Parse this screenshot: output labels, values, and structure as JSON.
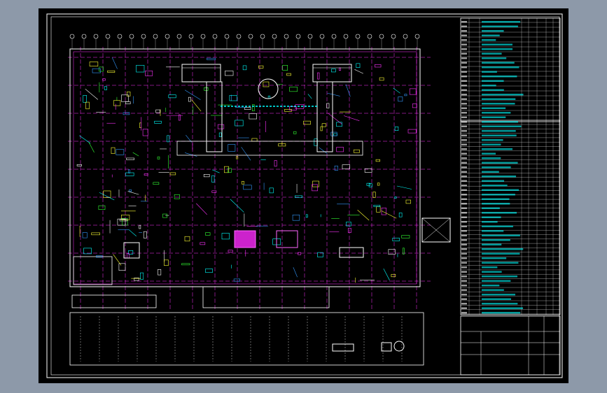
{
  "canvas": {
    "background_color": "#8d99a9",
    "sheet_color": "#000000",
    "line_colors": {
      "border": "#ffffff",
      "grid": "#ff33ff",
      "walls": "#ffffff",
      "equipment": "#00ffff",
      "green": "#33ff33",
      "yellow": "#ffff33",
      "blue": "#3399ff"
    }
  },
  "title_block": {
    "line1": "",
    "line2": "",
    "line3": ""
  }
}
